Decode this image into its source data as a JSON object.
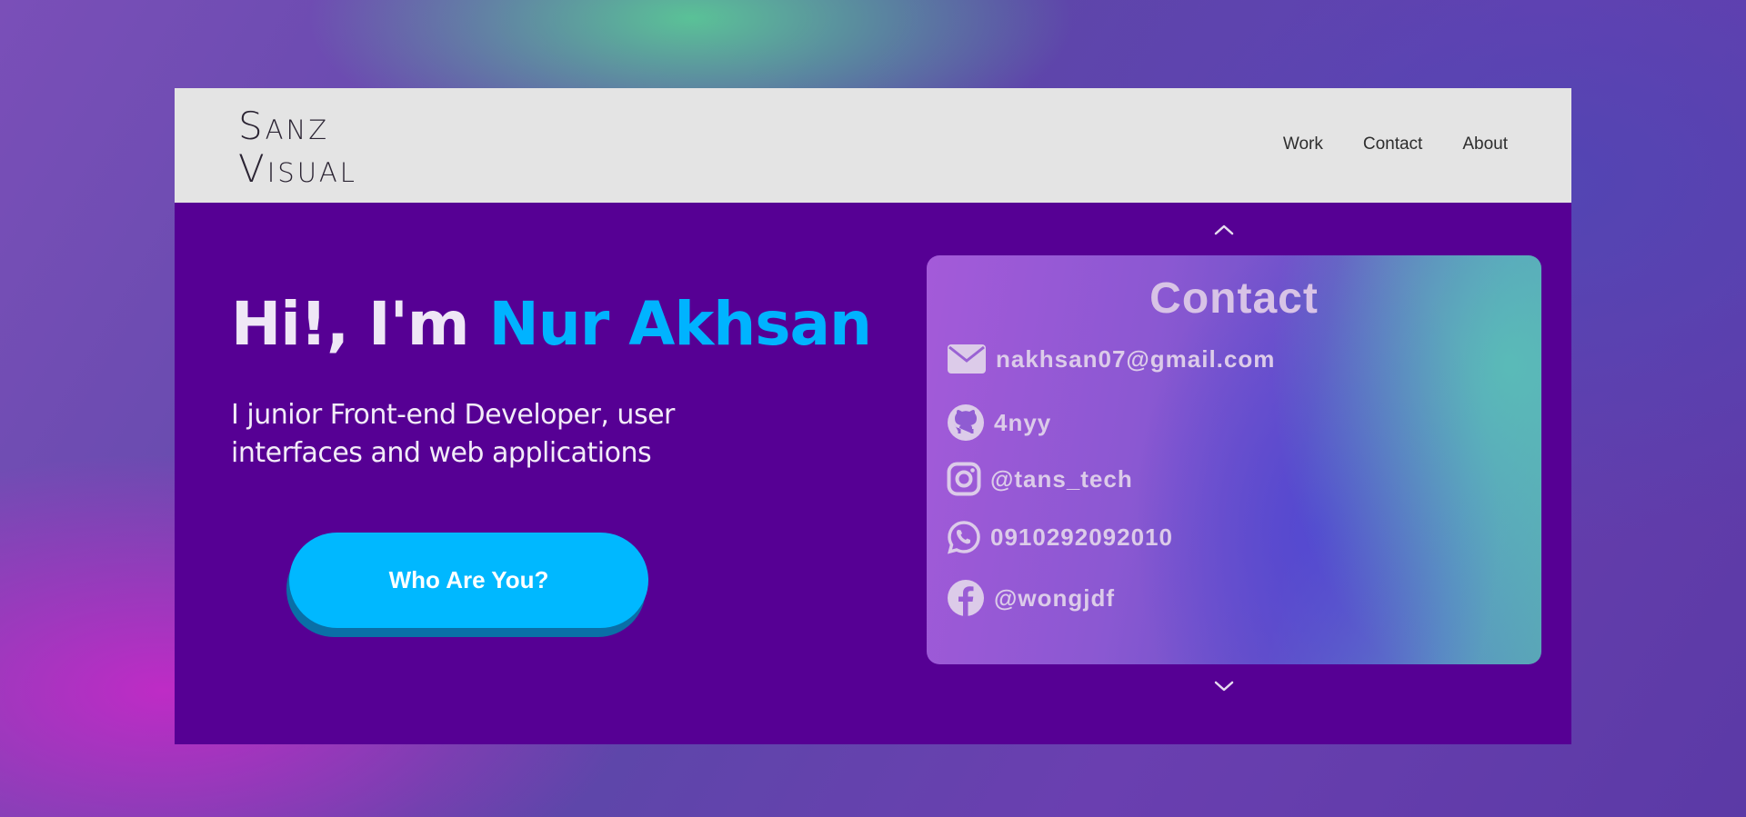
{
  "logo": {
    "line1": "Sanz",
    "line2": "Visual"
  },
  "nav": {
    "links": [
      "Work",
      "Contact",
      "About"
    ]
  },
  "hero": {
    "greeting": "Hi!, I'm ",
    "name": "Nur Akhsan",
    "subtitle": "I junior Front-end Developer, user interfaces and web applications",
    "cta_label": "Who Are You?"
  },
  "contact": {
    "title": "Contact",
    "items": [
      {
        "icon": "envelope-icon",
        "text": "nakhsan07@gmail.com"
      },
      {
        "icon": "github-icon",
        "text": "4nyy"
      },
      {
        "icon": "instagram-icon",
        "text": "@tans_tech"
      },
      {
        "icon": "whatsapp-icon",
        "text": "0910292092010"
      },
      {
        "icon": "facebook-icon",
        "text": "@wongjdf"
      }
    ]
  },
  "colors": {
    "navbar_bg": "#e4e4e4",
    "hero_bg": "#560094",
    "accent": "#00b3ff",
    "cta_bg": "#00b8ff",
    "cta_shadow": "#0a6fa7",
    "contact_text": "#dccbe9"
  }
}
